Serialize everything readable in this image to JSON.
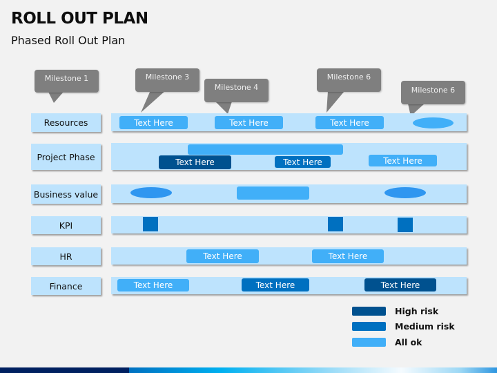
{
  "header": {
    "title": "ROLL OUT PLAN",
    "subtitle": "Phased Roll Out Plan"
  },
  "colors": {
    "high_risk": "#00518f",
    "medium_risk": "#0070c0",
    "all_ok": "#41aff8",
    "track": "#bde3fd",
    "callout": "#7f7f7f",
    "ellipse": "#2f96f0"
  },
  "milestones": [
    {
      "label": "Milestone 1"
    },
    {
      "label": "Milestone 3"
    },
    {
      "label": "Milestone 4"
    },
    {
      "label": "Milestone 6"
    },
    {
      "label": "Milestone 6"
    }
  ],
  "rows": [
    {
      "label": "Resources",
      "items": [
        {
          "type": "box",
          "text": "Text Here",
          "status": "all_ok"
        },
        {
          "type": "box",
          "text": "Text Here",
          "status": "all_ok"
        },
        {
          "type": "box",
          "text": "Text Here",
          "status": "all_ok"
        },
        {
          "type": "ellipse",
          "status": "all_ok"
        }
      ]
    },
    {
      "label": "Project Phase",
      "items": [
        {
          "type": "bar",
          "status": "all_ok"
        },
        {
          "type": "box",
          "text": "Text Here",
          "status": "high_risk"
        },
        {
          "type": "box",
          "text": "Text Here",
          "status": "medium_risk"
        },
        {
          "type": "box",
          "text": "Text Here",
          "status": "all_ok"
        }
      ]
    },
    {
      "label": "Business value",
      "items": [
        {
          "type": "ellipse",
          "status": "all_ok"
        },
        {
          "type": "box",
          "text": "",
          "status": "all_ok"
        },
        {
          "type": "ellipse",
          "status": "all_ok"
        }
      ]
    },
    {
      "label": "KPI",
      "items": [
        {
          "type": "square",
          "status": "medium_risk"
        },
        {
          "type": "square",
          "status": "medium_risk"
        },
        {
          "type": "square",
          "status": "medium_risk"
        }
      ]
    },
    {
      "label": "HR",
      "items": [
        {
          "type": "box",
          "text": "Text Here",
          "status": "all_ok"
        },
        {
          "type": "box",
          "text": "Text Here",
          "status": "all_ok"
        }
      ]
    },
    {
      "label": "Finance",
      "items": [
        {
          "type": "box",
          "text": "Text Here",
          "status": "all_ok"
        },
        {
          "type": "box",
          "text": "Text Here",
          "status": "medium_risk"
        },
        {
          "type": "box",
          "text": "Text Here",
          "status": "high_risk"
        }
      ]
    }
  ],
  "legend": [
    {
      "label": "High risk",
      "status": "high_risk"
    },
    {
      "label": "Medium risk",
      "status": "medium_risk"
    },
    {
      "label": "All ok",
      "status": "all_ok"
    }
  ]
}
